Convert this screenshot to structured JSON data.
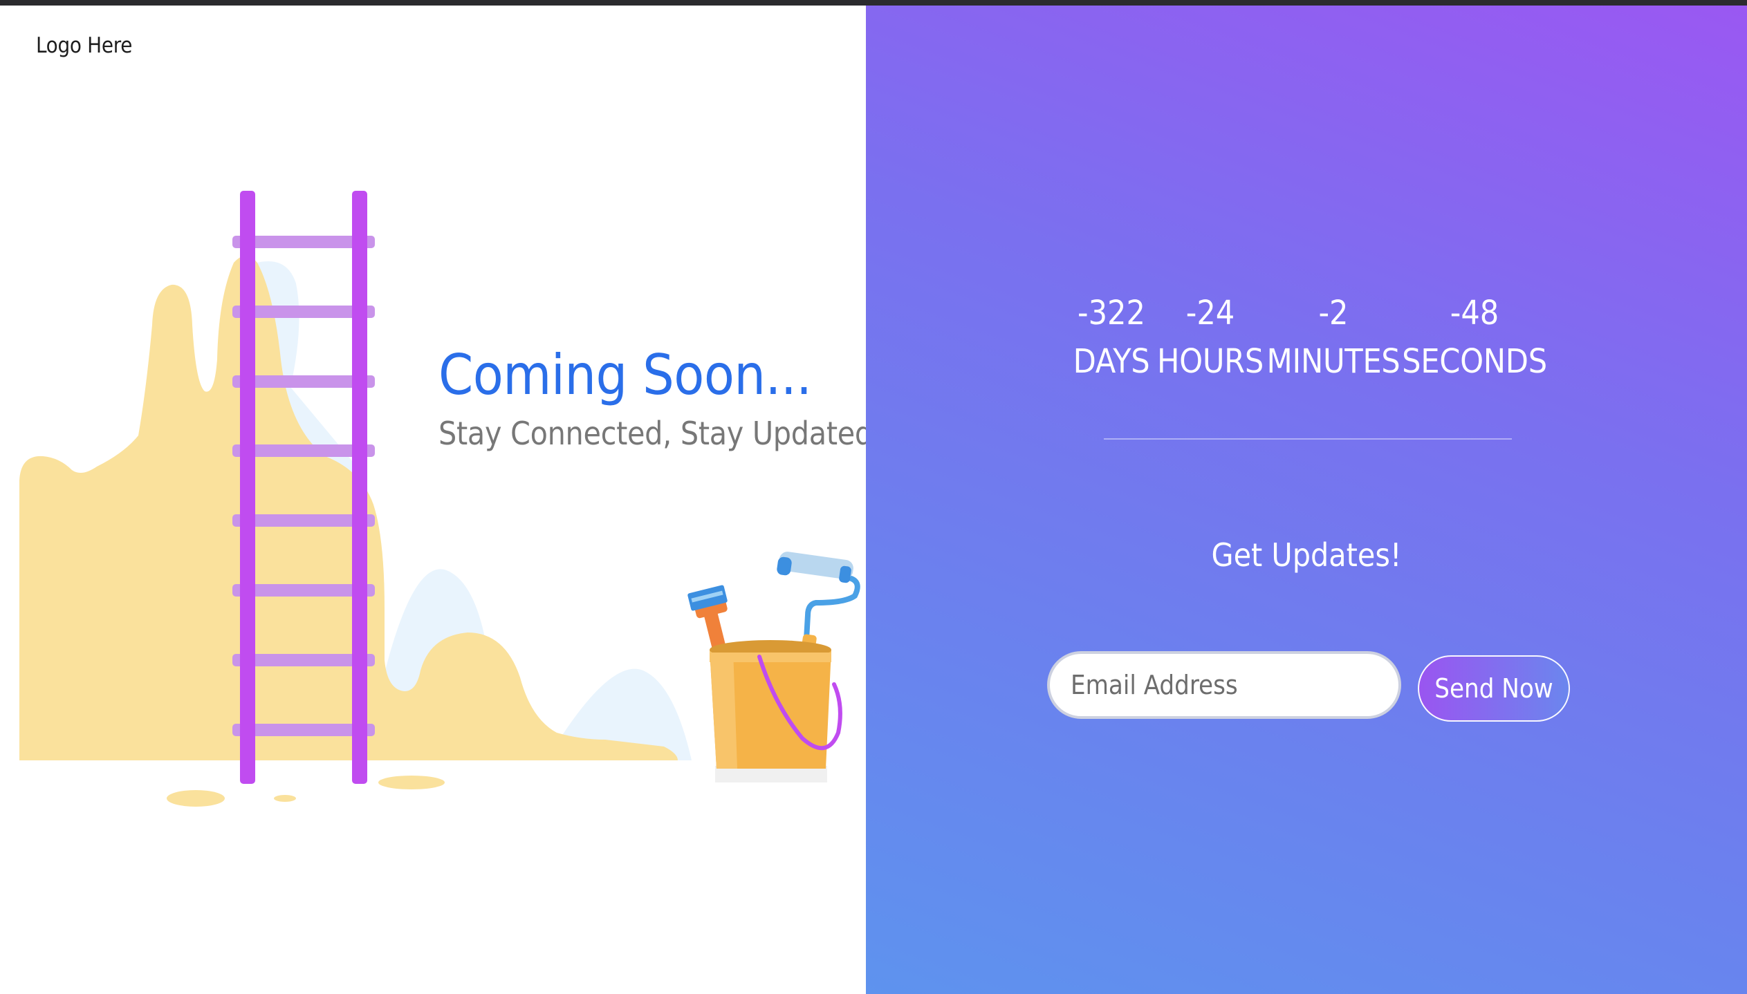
{
  "header": {
    "logo_text": "Logo Here"
  },
  "hero": {
    "headline": "Coming Soon...",
    "subheadline": "Stay Connected, Stay Updated"
  },
  "countdown": [
    {
      "value": "-322",
      "label": "DAYS"
    },
    {
      "value": "-24",
      "label": "HOURS"
    },
    {
      "value": "-2",
      "label": "MINUTES"
    },
    {
      "value": "-48",
      "label": "SECONDS"
    }
  ],
  "updates": {
    "heading": "Get Updates!",
    "email_placeholder": "Email Address",
    "email_value": "",
    "send_label": "Send Now"
  },
  "colors": {
    "headline": "#2a6ee9",
    "subheadline": "#777777",
    "gradient_top": "#9a58f2",
    "gradient_bottom": "#5e93ee",
    "ladder": "#c04cf0",
    "ladder_rungs": "#c993ea",
    "hills": "#fae19c",
    "bucket": "#f5b348"
  },
  "icons": {
    "illustration": "ladder-bucket-illustration",
    "bucket": "paint-bucket-icon",
    "roller": "paint-roller-icon",
    "brush": "paint-brush-icon"
  }
}
